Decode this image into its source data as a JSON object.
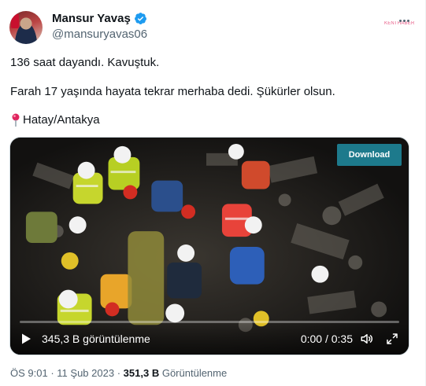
{
  "author": {
    "name": "Mansur Yavaş",
    "handle": "@mansuryavas06",
    "verified": true,
    "badge_color": "#1d9bf0"
  },
  "brand_watermark": "KENTHABER",
  "tweet": {
    "line1": "136 saat dayandı. Kavuştuk.",
    "line2": "Farah 17 yaşında hayata tekrar merhaba dedi. Şükürler olsun.",
    "location": "Hatay/Antakya",
    "location_icon": "pin-icon"
  },
  "video": {
    "download_label": "Download",
    "views_label": "345,3 B görüntülenme",
    "time_label": "0:00 / 0:35",
    "progress": 0
  },
  "footer": {
    "time": "ÖS 9:01",
    "separator": "·",
    "date": "11 Şub 2023",
    "view_count": "351,3 B",
    "view_label": "Görüntülenme"
  },
  "colors": {
    "text_primary": "#0f1419",
    "text_secondary": "#536471",
    "download_bg": "#1d7a8c",
    "accent": "#1d9bf0"
  }
}
